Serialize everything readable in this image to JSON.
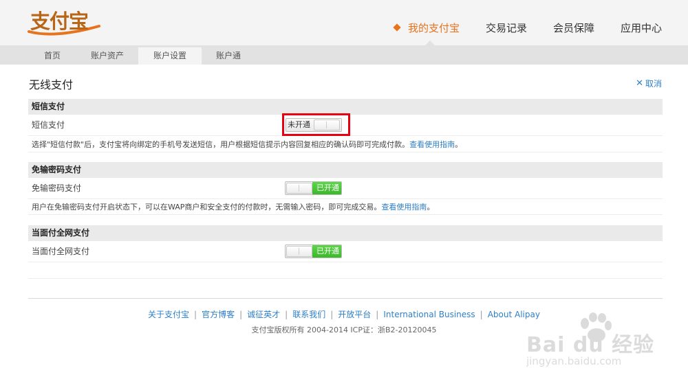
{
  "logo": {
    "text": "支付宝"
  },
  "main_nav": [
    {
      "label": "我的支付宝",
      "active": true
    },
    {
      "label": "交易记录",
      "active": false
    },
    {
      "label": "会员保障",
      "active": false
    },
    {
      "label": "应用中心",
      "active": false
    }
  ],
  "sub_nav": [
    {
      "label": "首页",
      "active": false
    },
    {
      "label": "账户资产",
      "active": false
    },
    {
      "label": "账户设置",
      "active": true
    },
    {
      "label": "账户通",
      "active": false
    }
  ],
  "page": {
    "title": "无线支付",
    "cancel_label": "取消"
  },
  "sections": [
    {
      "heading": "短信支付",
      "row_label": "短信支付",
      "toggle_label": "未开通",
      "toggle_state": "off",
      "description": "选择\"短信付款\"后，支付宝将向绑定的手机号发送短信，用户根据短信提示内容回复相应的确认码即可完成付款。",
      "link": "查看使用指南",
      "desc_end": "。"
    },
    {
      "heading": "免输密码支付",
      "row_label": "免输密码支付",
      "toggle_label": "已开通",
      "toggle_state": "on",
      "description": "用户在免输密码支付开启状态下，可以在WAP商户和安全支付的付款时，无需输入密码，即可完成交易。",
      "link": "查看使用指南",
      "desc_end": "。"
    },
    {
      "heading": "当面付全网支付",
      "row_label": "当面付全网支付",
      "toggle_label": "已开通",
      "toggle_state": "on"
    }
  ],
  "footer": {
    "links": [
      "关于支付宝",
      "官方博客",
      "诚征英才",
      "联系我们",
      "开放平台",
      "International Business",
      "About Alipay"
    ],
    "copyright": "支付宝版权所有 2004-2014 ICP证：浙B2-20120045"
  },
  "watermark": {
    "brand": "Bai du 经验",
    "url": "jingyan.baidu.com"
  },
  "colors": {
    "accent": "#e8731e",
    "link": "#2d7fc8",
    "toggle_on": "#3cb82b",
    "highlight": "#e60012"
  }
}
